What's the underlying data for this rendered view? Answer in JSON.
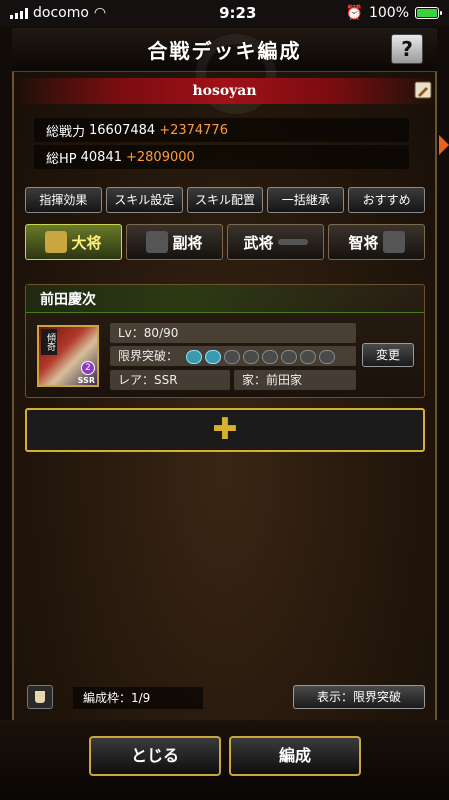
{
  "status": {
    "carrier": "docomo",
    "time": "9:23",
    "battery": "100%"
  },
  "header": {
    "title": "合戦デッキ編成",
    "help_label": "?",
    "user_name": "hosoyan"
  },
  "stats": {
    "power_label": "総戦力",
    "power_value": "16607484",
    "power_bonus": "+2374776",
    "hp_label": "総HP",
    "hp_value": "40841",
    "hp_bonus": "+2809000"
  },
  "actions": [
    "指揮効果",
    "スキル設定",
    "スキル配置",
    "一括継承",
    "おすすめ"
  ],
  "tabs": [
    {
      "label": "大将",
      "active": true
    },
    {
      "label": "副将",
      "active": false
    },
    {
      "label": "武将",
      "active": false
    },
    {
      "label": "智将",
      "active": false
    }
  ],
  "card": {
    "name": "前田慶次",
    "portrait_kanji": "傾奇",
    "portrait_badge": "2",
    "portrait_rarity": "SSR",
    "level_label": "Lv：",
    "level_current": "80",
    "level_max": "/90",
    "limit_label": "限界突破：",
    "limit_icons": [
      true,
      true,
      false,
      false,
      false,
      false,
      false,
      false
    ],
    "rarity_label": "レア：SSR",
    "house_label": "家：前田家",
    "change_label": "変更"
  },
  "add_slot": {
    "symbol": "✚"
  },
  "bottom": {
    "frame_count": "編成枠：1/9",
    "display_label": "表示：限界突破"
  },
  "footer": {
    "close_label": "とじる",
    "edit_label": "編成"
  },
  "colors": {
    "accent_gold": "#d8b030",
    "bonus_orange": "#ff9a3c",
    "tab_active": "#6a7a2a",
    "banner_red": "#a01218"
  }
}
